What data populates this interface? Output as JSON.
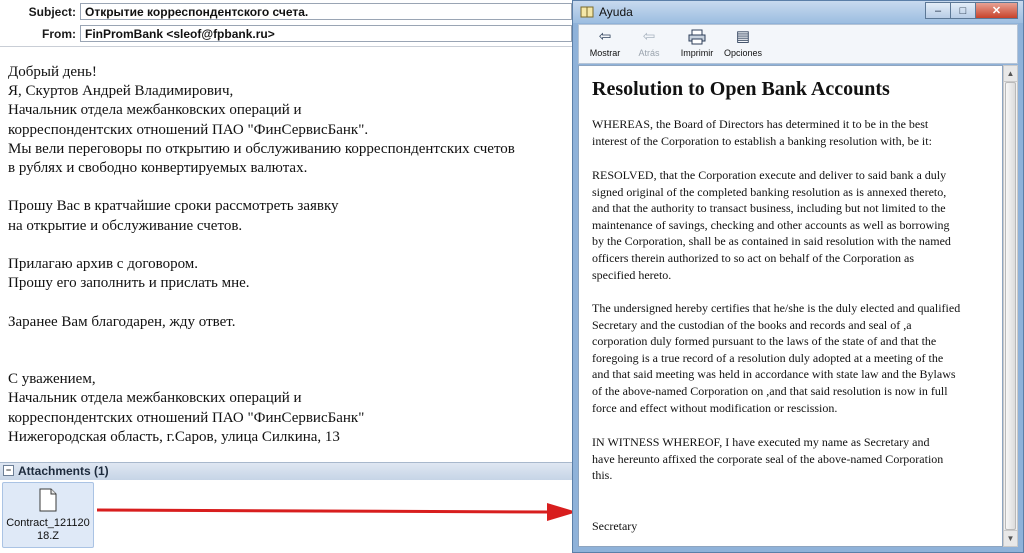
{
  "email": {
    "subject_label": "Subject:",
    "subject": "Открытие корреспондентского счета.",
    "from_label": "From:",
    "from": "FinPromBank <sleof@fpbank.ru>",
    "body_lines": [
      "Добрый день!",
      "Я, Скуртов Андрей Владимирович,",
      "Начальник отдела межбанковских операций и",
      "корреспондентских отношений ПАО \"ФинСервисБанк\".",
      "Мы вели переговоры по открытию и обслуживанию корреспондентских счетов",
      "в рублях и свободно конвертируемых валютах.",
      "",
      "Прошу Вас в кратчайшие сроки рассмотреть заявку",
      "на открытие и обслуживание счетов.",
      "",
      "Прилагаю архив с договором.",
      "Прошу его заполнить и прислать мне.",
      "",
      "Заранее Вам благодарен, жду ответ.",
      "",
      "",
      "С уважением,",
      "Начальник отдела межбанковских операций и",
      "корреспондентских отношений ПАО \"ФинСервисБанк\"",
      "Нижегородская область, г.Саров, улица Силкина, 13"
    ],
    "attachments_label": "Attachments (1)",
    "attachment": {
      "name_line1": "Contract_121120",
      "name_line2": "18.Z",
      "icon": "file-icon"
    }
  },
  "help_window": {
    "title": "Ayuda",
    "window_buttons": {
      "minimize": "–",
      "maximize": "□",
      "close": "✕"
    },
    "toolbar": [
      {
        "label": "Mostrar",
        "icon": "show-pane-icon",
        "glyph": "⇦",
        "enabled": true
      },
      {
        "label": "Atrás",
        "icon": "back-arrow-icon",
        "glyph": "⇦",
        "enabled": false
      },
      {
        "label": "Imprimir",
        "icon": "printer-icon",
        "glyph": "🖶",
        "enabled": true
      },
      {
        "label": "Opciones",
        "icon": "options-icon",
        "glyph": "▤",
        "enabled": true
      }
    ],
    "doc_title": "Resolution to Open Bank Accounts",
    "paragraphs": [
      [
        "WHEREAS, the Board of Directors has determined it to be in the best",
        "interest of the Corporation to establish a banking resolution with, be it:"
      ],
      [
        "RESOLVED, that the Corporation execute and deliver to said bank a duly",
        "signed original of the completed banking resolution as is annexed thereto,",
        "and that the authority to transact business, including but not limited to the",
        "maintenance of savings, checking and other accounts as well as borrowing",
        "by the Corporation, shall be as contained in said resolution with the named",
        "officers therein authorized to so act on behalf of the Corporation as",
        "specified hereto."
      ],
      [
        "The undersigned hereby certifies that he/she is the duly elected and qualified",
        "Secretary and the custodian of the books and records and seal of ,a",
        "corporation duly formed pursuant to the laws of the state of and that the",
        "foregoing is a true record of a resolution duly adopted at a meeting of the",
        "and that said meeting was held in accordance with state law and the Bylaws",
        "of the above-named Corporation on ,and that said resolution is now in full",
        "force and effect without modification or rescission."
      ],
      [
        "IN WITNESS WHEREOF, I have executed my name as Secretary and",
        "have hereunto affixed the corporate seal of the above-named Corporation",
        "this."
      ],
      [
        "Secretary"
      ]
    ]
  },
  "colors": {
    "arrow": "#d81e1e",
    "attachment_bg": "#dfe9f7",
    "titlebar": "#a9c6e6"
  }
}
